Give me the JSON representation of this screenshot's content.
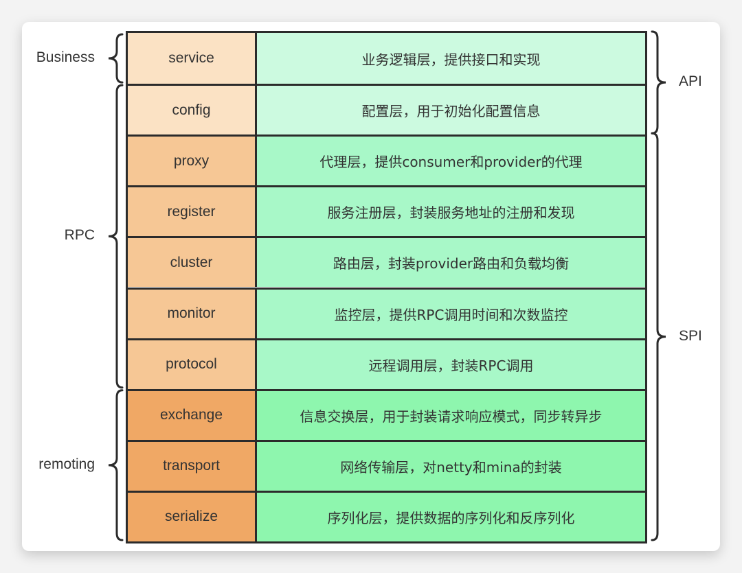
{
  "diagram": {
    "layers": [
      {
        "name": "service",
        "desc": "业务逻辑层，提供接口和实现",
        "left_color": "#FBE2C4",
        "right_color": "#CCFAE0"
      },
      {
        "name": "config",
        "desc": "配置层，用于初始化配置信息",
        "left_color": "#FBE2C4",
        "right_color": "#CCFAE0"
      },
      {
        "name": "proxy",
        "desc": "代理层，提供consumer和provider的代理",
        "left_color": "#F6C795",
        "right_color": "#A8F8C8"
      },
      {
        "name": "register",
        "desc": "服务注册层，封装服务地址的注册和发现",
        "left_color": "#F6C795",
        "right_color": "#A8F8C8"
      },
      {
        "name": "cluster",
        "desc": "路由层，封装provider路由和负载均衡",
        "left_color": "#F6C795",
        "right_color": "#A8F8C8"
      },
      {
        "name": "monitor",
        "desc": "监控层，提供RPC调用时间和次数监控",
        "left_color": "#F6C795",
        "right_color": "#A8F8C8"
      },
      {
        "name": "protocol",
        "desc": "远程调用层，封装RPC调用",
        "left_color": "#F6C795",
        "right_color": "#A8F8C8"
      },
      {
        "name": "exchange",
        "desc": "信息交换层，用于封装请求响应模式，同步转异步",
        "left_color": "#F0A865",
        "right_color": "#8EF6AE"
      },
      {
        "name": "transport",
        "desc": "网络传输层，对netty和mina的封装",
        "left_color": "#F0A865",
        "right_color": "#8EF6AE"
      },
      {
        "name": "serialize",
        "desc": "序列化层，提供数据的序列化和反序列化",
        "left_color": "#F0A865",
        "right_color": "#8EF6AE"
      }
    ],
    "left_groups": [
      {
        "label": "Business",
        "from": 0,
        "to": 0
      },
      {
        "label": "RPC",
        "from": 1,
        "to": 6
      },
      {
        "label": "remoting",
        "from": 7,
        "to": 9
      }
    ],
    "right_groups": [
      {
        "label": "API",
        "from": 0,
        "to": 1
      },
      {
        "label": "SPI",
        "from": 2,
        "to": 9
      }
    ],
    "line_color": "#2b2b2b"
  }
}
